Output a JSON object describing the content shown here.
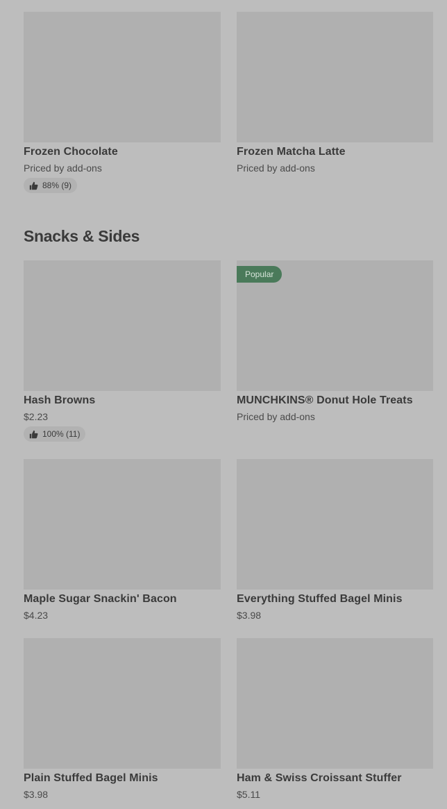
{
  "section_top": {
    "items": [
      {
        "name": "Frozen Chocolate",
        "price": "Priced by add-ons",
        "rating": "88% (9)"
      },
      {
        "name": "Frozen Matcha Latte",
        "price": "Priced by add-ons"
      }
    ]
  },
  "snacks": {
    "title": "Snacks & Sides",
    "items": [
      {
        "name": "Hash Browns",
        "price": "$2.23",
        "rating": "100% (11)"
      },
      {
        "name": "MUNCHKINS® Donut Hole Treats",
        "price": "Priced by add-ons",
        "badge": "Popular"
      },
      {
        "name": "Maple Sugar Snackin' Bacon",
        "price": "$4.23"
      },
      {
        "name": "Everything Stuffed Bagel Minis",
        "price": "$3.98"
      },
      {
        "name": "Plain Stuffed Bagel Minis",
        "price": "$3.98"
      },
      {
        "name": "Ham & Swiss Croissant Stuffer",
        "price": "$5.11"
      }
    ]
  },
  "colors": {
    "background": "#bdbdbd",
    "thumbnail": "#b0b0b0",
    "badge": "#4a7a5a"
  },
  "icons": {
    "rating": "thumbs-up-icon"
  }
}
